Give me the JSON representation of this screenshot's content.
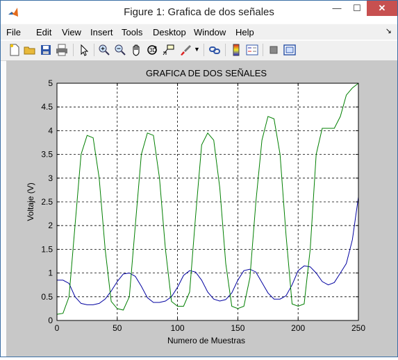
{
  "window": {
    "title": "Figure 1: Grafica de dos señales",
    "minimize": "—",
    "maximize": "☐",
    "close": "✕"
  },
  "menu": [
    "File",
    "Edit",
    "View",
    "Insert",
    "Tools",
    "Desktop",
    "Window",
    "Help"
  ],
  "toolbar_icons": [
    "new-figure-icon",
    "open-file-icon",
    "save-icon",
    "print-icon",
    "pointer-icon",
    "zoom-in-icon",
    "zoom-out-icon",
    "pan-icon",
    "rotate-3d-icon",
    "data-cursor-icon",
    "brush-icon",
    "link-plot-icon",
    "colorbar-icon",
    "legend-icon",
    "hide-plot-tools-icon",
    "show-plot-tools-icon"
  ],
  "chart_data": {
    "type": "line",
    "title": "GRAFICA DE DOS SEÑALES",
    "xlabel": "Numero de Muestras",
    "ylabel": "Voltaje (V)",
    "xlim": [
      0,
      250
    ],
    "ylim": [
      0,
      5
    ],
    "xticks": [
      "0",
      "50",
      "100",
      "150",
      "200",
      "250"
    ],
    "yticks": [
      "0",
      "0.5",
      "1",
      "1.5",
      "2",
      "2.5",
      "3",
      "3.5",
      "4",
      "4.5",
      "5"
    ],
    "grid": "dashed",
    "series": [
      {
        "color": "#0000a0",
        "x": [
          0,
          5,
          10,
          15,
          20,
          25,
          30,
          35,
          40,
          45,
          50,
          55,
          60,
          65,
          70,
          75,
          80,
          85,
          90,
          95,
          100,
          105,
          110,
          115,
          120,
          125,
          130,
          135,
          140,
          145,
          150,
          155,
          160,
          165,
          170,
          175,
          180,
          185,
          190,
          195,
          200,
          205,
          210,
          215,
          220,
          225,
          230,
          235,
          240,
          245,
          250
        ],
        "y": [
          0.85,
          0.85,
          0.78,
          0.5,
          0.36,
          0.33,
          0.33,
          0.36,
          0.45,
          0.62,
          0.82,
          0.98,
          1.0,
          0.93,
          0.72,
          0.48,
          0.38,
          0.38,
          0.41,
          0.5,
          0.7,
          0.95,
          1.05,
          1.02,
          0.85,
          0.6,
          0.45,
          0.41,
          0.44,
          0.58,
          0.85,
          1.05,
          1.08,
          1.02,
          0.8,
          0.58,
          0.45,
          0.45,
          0.52,
          0.75,
          1.05,
          1.15,
          1.13,
          1.0,
          0.82,
          0.75,
          0.8,
          1.0,
          1.2,
          1.7,
          2.6
        ]
      },
      {
        "color": "#007f00",
        "x": [
          0,
          5,
          10,
          15,
          20,
          25,
          30,
          35,
          40,
          45,
          50,
          55,
          60,
          65,
          70,
          75,
          80,
          85,
          90,
          95,
          100,
          105,
          110,
          115,
          120,
          125,
          130,
          135,
          140,
          145,
          150,
          155,
          160,
          165,
          170,
          175,
          180,
          185,
          190,
          195,
          200,
          205,
          210,
          215,
          220,
          225,
          230,
          235,
          240,
          245,
          250
        ],
        "y": [
          0.13,
          0.15,
          0.5,
          2.0,
          3.5,
          3.9,
          3.85,
          3.0,
          1.5,
          0.4,
          0.25,
          0.22,
          0.5,
          2.0,
          3.5,
          3.95,
          3.9,
          3.0,
          1.5,
          0.4,
          0.3,
          0.3,
          0.6,
          2.2,
          3.7,
          3.95,
          3.8,
          2.8,
          1.2,
          0.3,
          0.25,
          0.3,
          0.9,
          2.5,
          3.8,
          4.3,
          4.25,
          3.5,
          1.8,
          0.35,
          0.3,
          0.35,
          1.5,
          3.5,
          4.05,
          4.05,
          4.05,
          4.3,
          4.75,
          4.9,
          5.0
        ]
      }
    ]
  }
}
